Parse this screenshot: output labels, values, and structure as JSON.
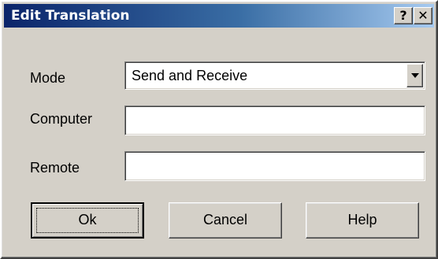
{
  "window": {
    "title": "Edit Translation",
    "help_button": "?",
    "close_button": "✕"
  },
  "form": {
    "mode": {
      "label": "Mode",
      "selected": "Send and Receive",
      "icon": "dropdown-arrow"
    },
    "computer": {
      "label": "Computer",
      "value": ""
    },
    "remote": {
      "label": "Remote",
      "value": ""
    }
  },
  "buttons": {
    "ok": "Ok",
    "cancel": "Cancel",
    "help": "Help"
  },
  "colors": {
    "face": "#d4d0c8",
    "title_start": "#0a246a",
    "title_end": "#a6caf0"
  }
}
